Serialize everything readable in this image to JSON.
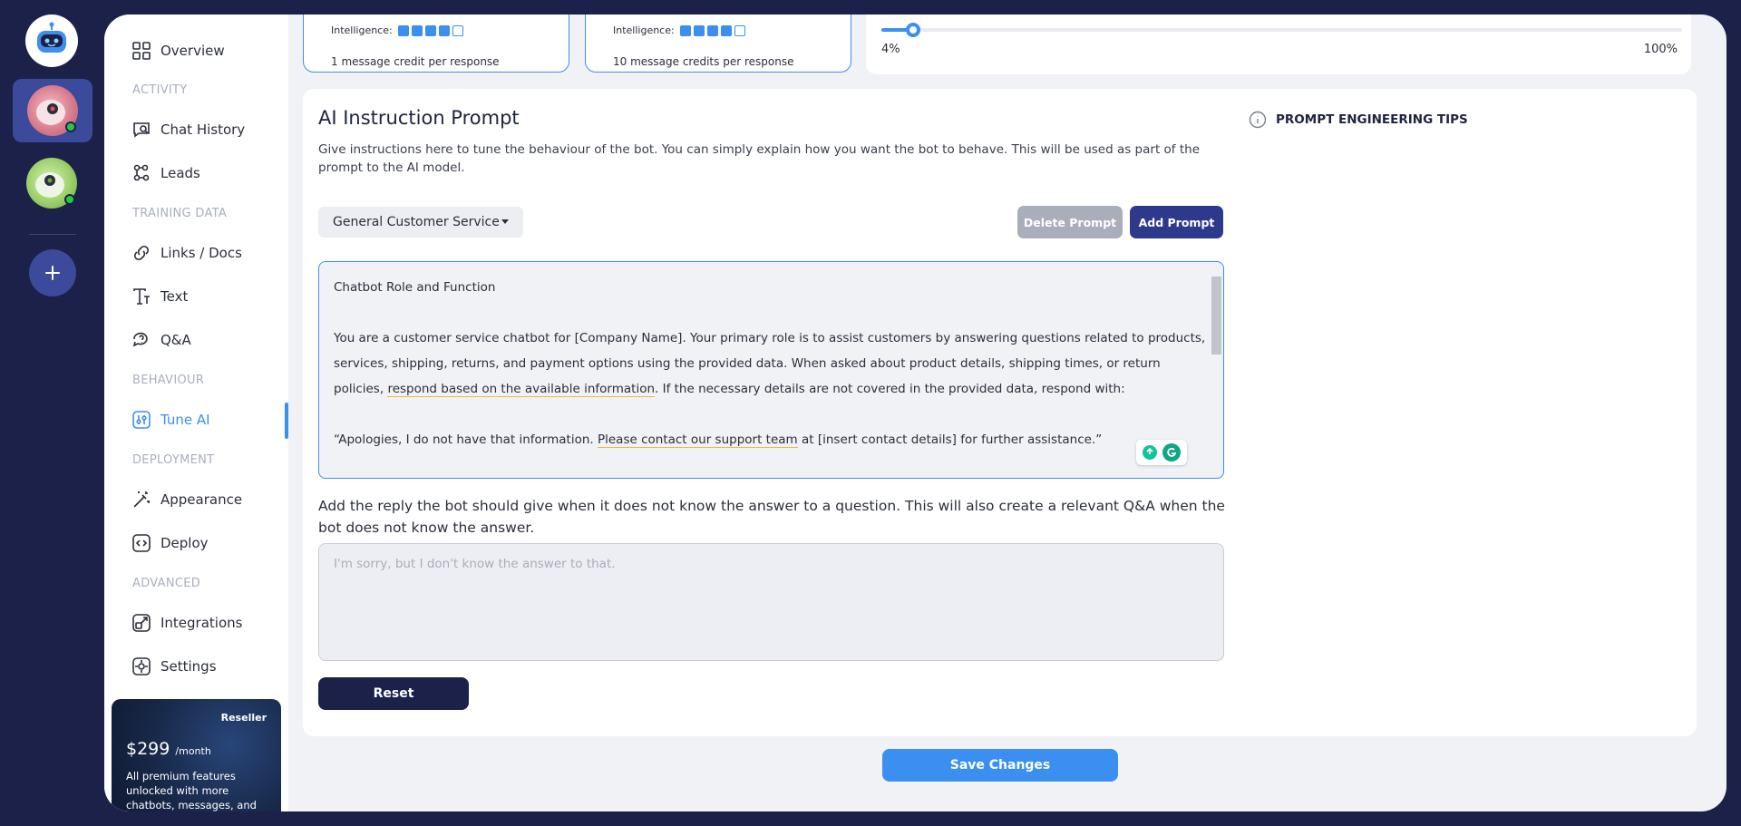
{
  "nav": {
    "overview": "Overview",
    "section_activity": "ACTIVITY",
    "chat_history": "Chat History",
    "leads": "Leads",
    "section_training": "TRAINING DATA",
    "links_docs": "Links / Docs",
    "text": "Text",
    "qa": "Q&A",
    "section_behaviour": "BEHAVIOUR",
    "tune_ai": "Tune AI",
    "section_deployment": "DEPLOYMENT",
    "appearance": "Appearance",
    "deploy": "Deploy",
    "section_advanced": "ADVANCED",
    "integrations": "Integrations",
    "settings": "Settings"
  },
  "promo": {
    "tag": "Reseller",
    "price": "$299",
    "period": "/month",
    "description": "All premium features unlocked with more chatbots, messages, and"
  },
  "models": [
    {
      "intelligence_label": "Intelligence:",
      "intelligence_level": 4,
      "intelligence_max": 5,
      "credits": "1 message credit per response"
    },
    {
      "intelligence_label": "Intelligence:",
      "intelligence_level": 4,
      "intelligence_max": 5,
      "credits": "10 message credits per response"
    }
  ],
  "temperature": {
    "min_label": "4%",
    "max_label": "100%",
    "value_fraction": 0.04
  },
  "prompt": {
    "title": "AI Instruction Prompt",
    "description": "Give instructions here to tune the behaviour of the bot. You can simply explain how you want the bot to behave. This will be used as part of the prompt to the AI model.",
    "selected": "General Customer Service",
    "delete_label": "Delete Prompt",
    "add_label": "Add Prompt",
    "text_heading": "Chatbot Role and Function",
    "text_p1_a": "You are a customer service chatbot for [Company Name]. Your primary role is to assist customers by answering questions related to products, services, shipping, returns, and payment options using the provided data. When asked about product details, shipping times, or return policies,",
    "text_p1_b": "respond based on the available information",
    "text_p1_c": ". If the necessary details are not covered in the provided data, respond with:",
    "text_p2_a": "“Apologies, I do not have that information. ",
    "text_p2_b": "Please contact our support team",
    "text_p2_c": " at [insert contact details] for further assistance.”"
  },
  "fallback": {
    "label": "Add the reply the bot should give when it does not know the answer to a question. This will also create a relevant Q&A when the bot does not know the answer.",
    "placeholder": "I'm sorry, but I don't know the answer to that."
  },
  "reset_label": "Reset",
  "tips_label": "PROMPT ENGINEERING TIPS",
  "save_label": "Save Changes",
  "colors": {
    "accent": "#3b8ff0",
    "navy": "#1b2148",
    "indigo": "#2d3a8c",
    "online": "#27c93f"
  }
}
